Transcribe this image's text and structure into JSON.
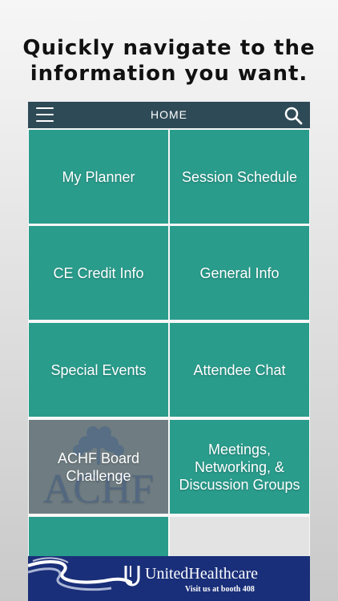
{
  "headline": {
    "line1": "Quickly navigate to the",
    "line2": "information you want."
  },
  "topbar": {
    "title": "HOME",
    "menu_icon": "hamburger-menu-icon",
    "search_icon": "search-icon"
  },
  "tiles": [
    {
      "label": "My Planner"
    },
    {
      "label": "Session Schedule"
    },
    {
      "label": "CE Credit Info"
    },
    {
      "label": "General Info"
    },
    {
      "label": "Special Events"
    },
    {
      "label": "Attendee Chat"
    },
    {
      "label": "ACHF Board Challenge",
      "logo_text": "ACHF"
    },
    {
      "label": "Meetings, Networking, & Discussion Groups"
    }
  ],
  "banner": {
    "brand": "UnitedHealthcare",
    "subtitle": "Visit us at booth 408"
  },
  "colors": {
    "topbar": "#2e4a56",
    "tile": "#2a9c8c",
    "tile_achf": "#6f7d82",
    "banner": "#1a2f79"
  }
}
